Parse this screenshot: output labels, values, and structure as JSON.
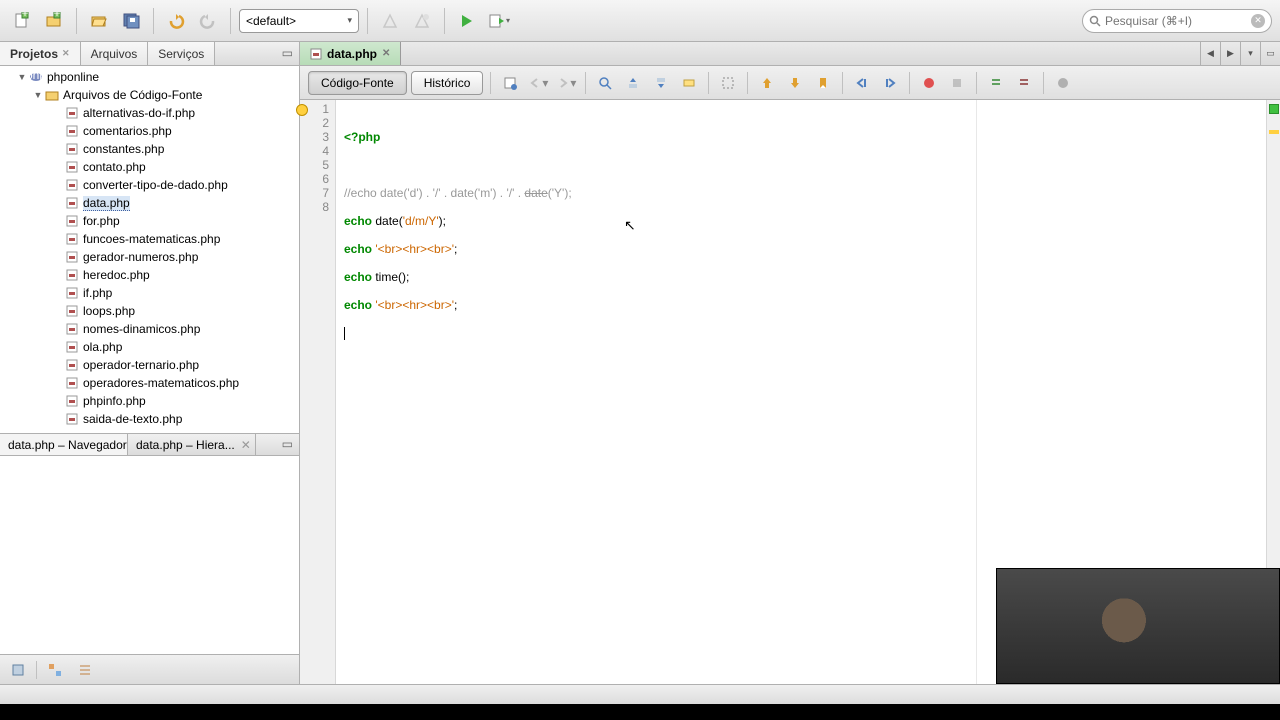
{
  "toolbar": {
    "config_selected": "<default>"
  },
  "search": {
    "placeholder": "Pesquisar (⌘+I)"
  },
  "left": {
    "tabs": [
      "Projetos",
      "Arquivos",
      "Serviços"
    ],
    "project": "phponline",
    "folder": "Arquivos de Código-Fonte",
    "files": [
      "alternativas-do-if.php",
      "comentarios.php",
      "constantes.php",
      "contato.php",
      "converter-tipo-de-dado.php",
      "data.php",
      "for.php",
      "funcoes-matematicas.php",
      "gerador-numeros.php",
      "heredoc.php",
      "if.php",
      "loops.php",
      "nomes-dinamicos.php",
      "ola.php",
      "operador-ternario.php",
      "operadores-matematicos.php",
      "phpinfo.php",
      "saida-de-texto.php"
    ],
    "selected_file": "data.php",
    "bottom_tabs": [
      "data.php – Navegador",
      "data.php – Hiera..."
    ]
  },
  "editor": {
    "tab_label": "data.php",
    "view_source": "Código-Fonte",
    "view_history": "Histórico",
    "lines": [
      {
        "n": 1,
        "hint": true,
        "t": "open"
      },
      {
        "n": 2,
        "t": "blank"
      },
      {
        "n": 3,
        "t": "comment"
      },
      {
        "n": 4,
        "t": "l4"
      },
      {
        "n": 5,
        "t": "l5"
      },
      {
        "n": 6,
        "t": "l6"
      },
      {
        "n": 7,
        "t": "l7"
      },
      {
        "n": 8,
        "t": "cursor"
      }
    ],
    "code": {
      "open": "<?php",
      "comment_prefix": "//echo date('d') . '/' . date('m') . '/' . ",
      "comment_dep": "date",
      "comment_suffix": "('Y');",
      "echo": "echo",
      "date_fn": " date(",
      "date_arg": "'d/m/Y'",
      "date_close": ");",
      "br_str": "'<br><hr><br>'",
      "semi": ";",
      "time_call": " time();"
    }
  }
}
